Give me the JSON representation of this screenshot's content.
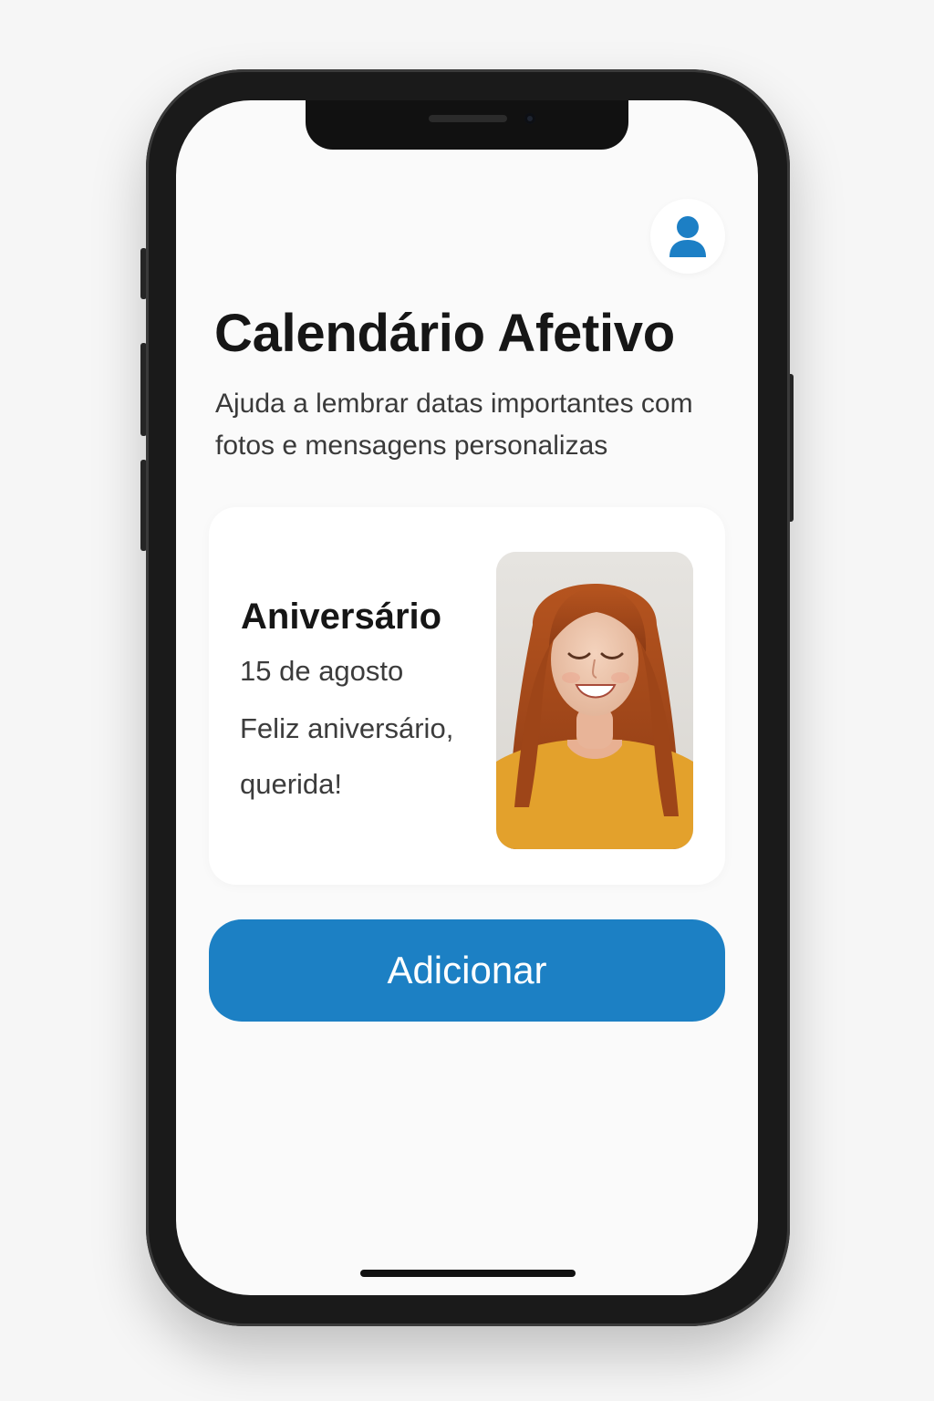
{
  "app": {
    "title": "Calendário Afetivo",
    "subtitle": "Ajuda a lembrar datas importantes com fotos e mensagens personalizas"
  },
  "header": {
    "profile_icon": "user-icon",
    "accent_color": "#1c80c4"
  },
  "event_card": {
    "title": "Aniversário",
    "date": "15 de agosto",
    "message": "Feliz aniversário, querida!",
    "photo_icon": "portrait-photo"
  },
  "actions": {
    "add_label": "Adicionar",
    "add_color": "#1c80c4"
  }
}
